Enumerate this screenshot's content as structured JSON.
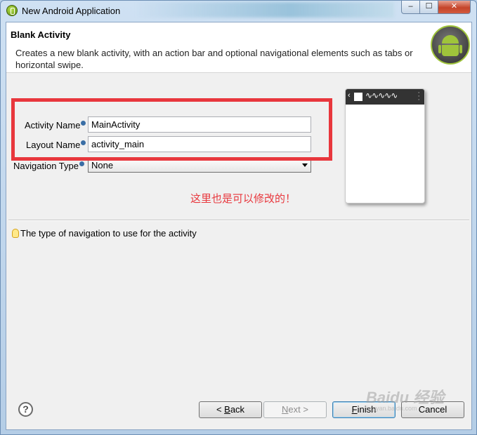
{
  "window": {
    "title": "New Android Application"
  },
  "header": {
    "title": "Blank Activity",
    "description": "Creates a new blank activity, with an action bar and optional navigational elements such as tabs or horizontal swipe."
  },
  "form": {
    "activity_name": {
      "label": "Activity Name",
      "value": "MainActivity"
    },
    "layout_name": {
      "label": "Layout Name",
      "value": "activity_main"
    },
    "navigation_type": {
      "label": "Navigation Type",
      "value": "None"
    }
  },
  "annotation": {
    "text": "这里也是可以修改的！",
    "color": "#e8373d"
  },
  "hint": {
    "text": "The type of navigation to use for the activity"
  },
  "buttons": {
    "help": "?",
    "back_prefix": "< ",
    "back_mnemonic": "B",
    "back_rest": "ack",
    "next_prefix": "",
    "next_mnemonic": "N",
    "next_rest": "ext >",
    "finish_mnemonic": "F",
    "finish_rest": "inish",
    "cancel": "Cancel"
  },
  "window_controls": {
    "minimize": "‒",
    "maximize": "☐",
    "close": "✕"
  },
  "watermark": {
    "text": "Baidu 经验",
    "sub": "jingyan.baidu.com"
  },
  "icons": [
    "android-app-icon",
    "android-logo-icon",
    "info-icon",
    "dropdown-arrow-icon",
    "lightbulb-icon",
    "help-icon"
  ]
}
